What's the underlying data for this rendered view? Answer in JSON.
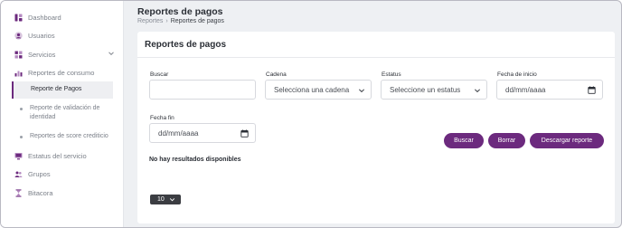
{
  "sidebar": {
    "items": [
      {
        "label": "Dashboard",
        "icon": "dashboard-icon"
      },
      {
        "label": "Usuarios",
        "icon": "user-icon"
      },
      {
        "label": "Servicios",
        "icon": "grid-icon"
      },
      {
        "label": "Reportes de consumo",
        "icon": "bar-chart-icon"
      },
      {
        "label": "Estatus del servicio",
        "icon": "monitor-icon"
      },
      {
        "label": "Grupos",
        "icon": "group-icon"
      },
      {
        "label": "Bitacora",
        "icon": "hourglass-icon"
      }
    ],
    "sub_items": [
      {
        "label": "Reporte de Pagos"
      },
      {
        "label": "Reporte de validación de identidad"
      },
      {
        "label": "Reportes de score crediticio"
      }
    ]
  },
  "header": {
    "title": "Reportes de pagos",
    "breadcrumb": [
      "Reportes",
      "Reportes de pagos"
    ],
    "separator": "›"
  },
  "card": {
    "title": "Reportes de pagos",
    "filters": {
      "buscar": {
        "label": "Buscar",
        "value": ""
      },
      "cadena": {
        "label": "Cadena",
        "value": "Selecciona una cadena"
      },
      "estatus": {
        "label": "Estatus",
        "value": "Seleccione un estatus"
      },
      "fecha_inicio": {
        "label": "Fecha de inicio",
        "value": "dd/mm/aaaa"
      },
      "fecha_fin": {
        "label": "Fecha fin",
        "value": "dd/mm/aaaa"
      }
    },
    "buttons": {
      "buscar": "Buscar",
      "borrar": "Borrar",
      "descargar": "Descargar reporte"
    },
    "empty_message": "No hay resultados disponibles",
    "page_size": "10"
  },
  "colors": {
    "accent": "#6c2a7e",
    "background": "#eef0f3",
    "card": "#ffffff"
  }
}
